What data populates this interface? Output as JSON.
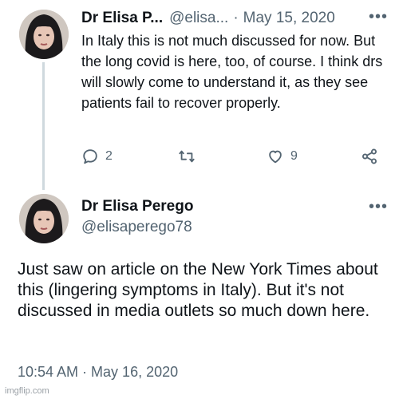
{
  "tweet1": {
    "author_name": "Dr Elisa P...",
    "handle": "@elisa...",
    "separator": "·",
    "date": "May 15, 2020",
    "more": "•••",
    "text": "In Italy this is not much discussed for now. But the long covid is here, too, of course. I think drs will slowly come to understand it, as they see patients fail to recover properly.",
    "reply_count": "2",
    "like_count": "9"
  },
  "tweet2": {
    "author_name": "Dr Elisa Perego",
    "handle": "@elisaperego78",
    "more": "•••",
    "text": "Just saw on article on the New York Times about this (lingering symptoms in Italy). But it's not discussed in media outlets so much down here.",
    "timestamp": "10:54 AM · May 16, 2020"
  },
  "watermark": "imgflip.com",
  "icons": {
    "reply": "reply-icon",
    "retweet": "retweet-icon",
    "like": "heart-icon",
    "share": "share-icon"
  },
  "colors": {
    "text": "#0f1419",
    "secondary": "#536471",
    "thread_line": "#cfd9de"
  }
}
